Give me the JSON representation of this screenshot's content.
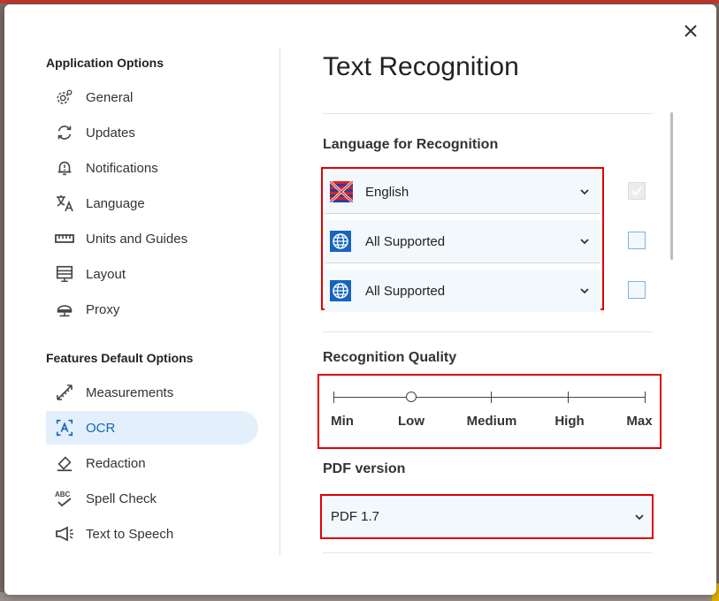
{
  "sidebar": {
    "app_section": "Application Options",
    "app_items": [
      {
        "label": "General",
        "icon": "gear-icon"
      },
      {
        "label": "Updates",
        "icon": "refresh-icon"
      },
      {
        "label": "Notifications",
        "icon": "bell-icon"
      },
      {
        "label": "Language",
        "icon": "translate-icon"
      },
      {
        "label": "Units and Guides",
        "icon": "ruler-icon"
      },
      {
        "label": "Layout",
        "icon": "layout-icon"
      },
      {
        "label": "Proxy",
        "icon": "proxy-icon"
      }
    ],
    "features_section": "Features Default Options",
    "feature_items": [
      {
        "label": "Measurements",
        "icon": "measure-icon"
      },
      {
        "label": "OCR",
        "icon": "ocr-icon",
        "active": true
      },
      {
        "label": "Redaction",
        "icon": "eraser-icon"
      },
      {
        "label": "Spell Check",
        "icon": "spellcheck-icon"
      },
      {
        "label": "Text to Speech",
        "icon": "megaphone-icon"
      }
    ]
  },
  "main": {
    "title": "Text Recognition",
    "language_label": "Language for Recognition",
    "languages": [
      {
        "value": "English",
        "icon": "uk-flag-icon",
        "checked": true
      },
      {
        "value": "All Supported",
        "icon": "globe-icon",
        "checked": false
      },
      {
        "value": "All Supported",
        "icon": "globe-icon",
        "checked": false
      }
    ],
    "quality_label": "Recognition Quality",
    "quality_levels": [
      "Min",
      "Low",
      "Medium",
      "High",
      "Max"
    ],
    "quality_selected": "Low",
    "pdf_label": "PDF version",
    "pdf_value": "PDF 1.7"
  },
  "colors": {
    "accent": "#1565c0",
    "highlight_border": "#e00000",
    "active_bg": "#e3f0fb"
  }
}
